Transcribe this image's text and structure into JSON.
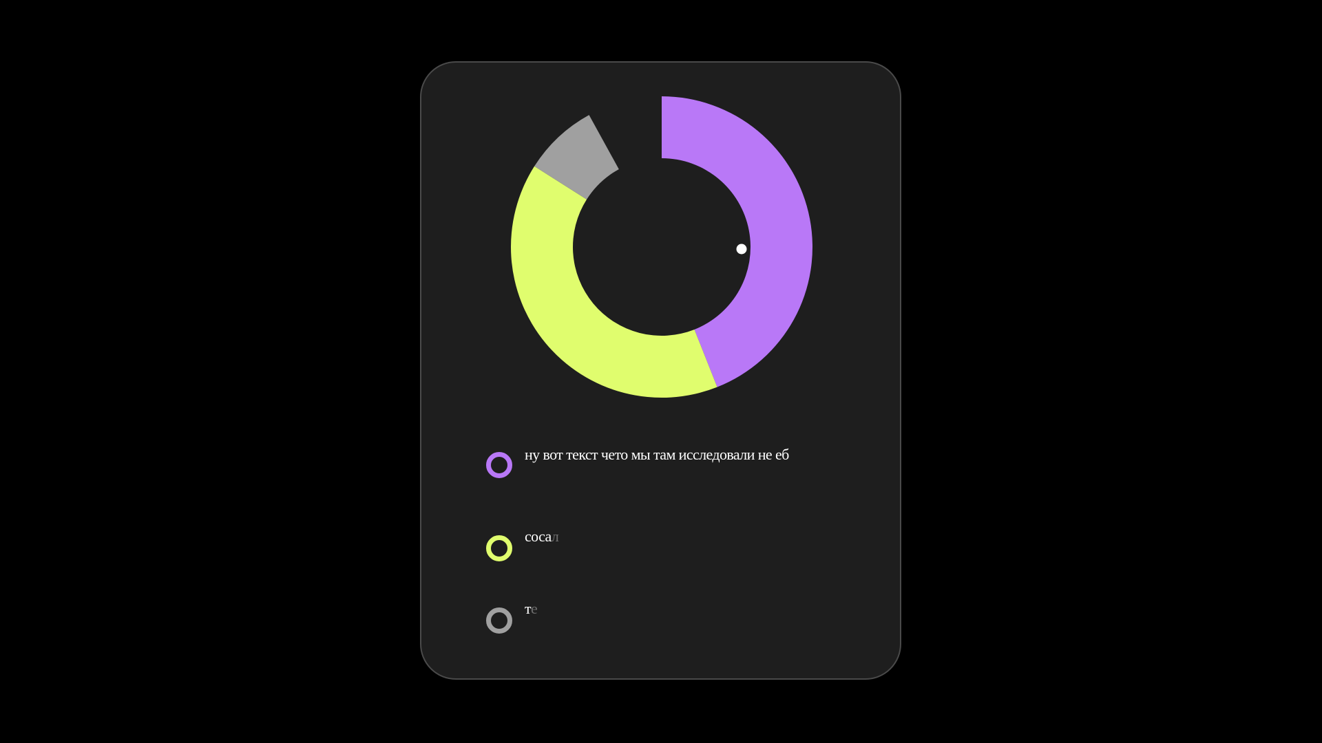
{
  "colors": {
    "page_background": "#000000",
    "card_background": "#1e1e1e",
    "card_border": "#4a4a4a",
    "marker": "#ffffff"
  },
  "chart_data": {
    "type": "pie",
    "variant": "donut",
    "title": "",
    "series": [
      {
        "values": [
          {
            "value": 44,
            "color": "#b978f7"
          },
          {
            "value": 40,
            "color": "#e0fd6e"
          },
          {
            "value": 8,
            "color": "#a0a0a0"
          }
        ]
      }
    ],
    "gap_value": 8,
    "legend_position": "below"
  },
  "legend": [
    {
      "text": "ну вот текст чето мы там исследовали не еб",
      "faded": "",
      "color": "#b978f7"
    },
    {
      "text": "соса",
      "faded": "л",
      "color": "#e0fd6e"
    },
    {
      "text": "т",
      "faded": "е",
      "color": "#a0a0a0"
    }
  ]
}
